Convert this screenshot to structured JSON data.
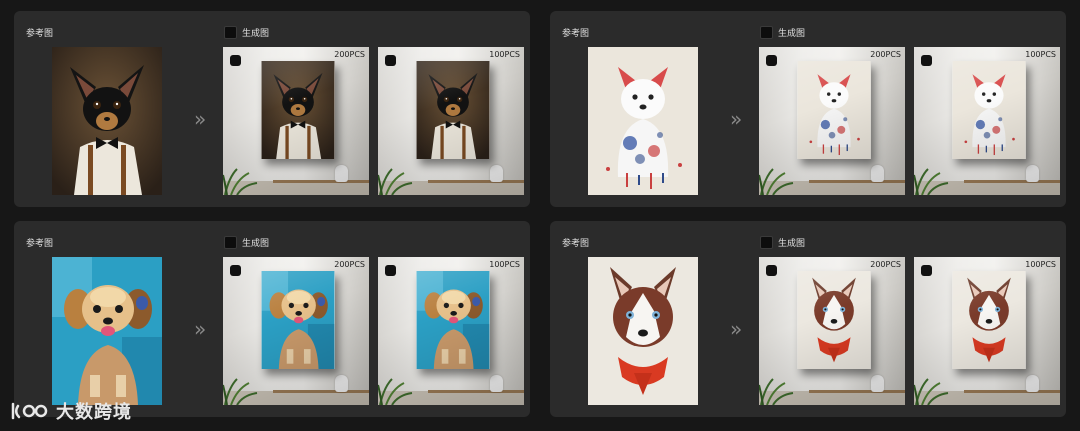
{
  "cards": [
    {
      "ref_label": "参考图",
      "gen_label": "生成图",
      "qty": [
        "200PCS",
        "100PCS"
      ],
      "art": "chihuahua-portrait"
    },
    {
      "ref_label": "参考图",
      "gen_label": "生成图",
      "qty": [
        "200PCS",
        "100PCS"
      ],
      "art": "westie-watercolor"
    },
    {
      "ref_label": "参考图",
      "gen_label": "生成图",
      "qty": [
        "200PCS",
        "100PCS"
      ],
      "art": "yorkie-painting"
    },
    {
      "ref_label": "参考图",
      "gen_label": "生成图",
      "qty": [
        "200PCS",
        "100PCS"
      ],
      "art": "husky-portrait"
    }
  ],
  "arrow_glyph": "»",
  "watermark": "大数跨境",
  "colors": {
    "background": "#171717",
    "card": "#2b2b2b",
    "label": "#e0e0e0"
  }
}
